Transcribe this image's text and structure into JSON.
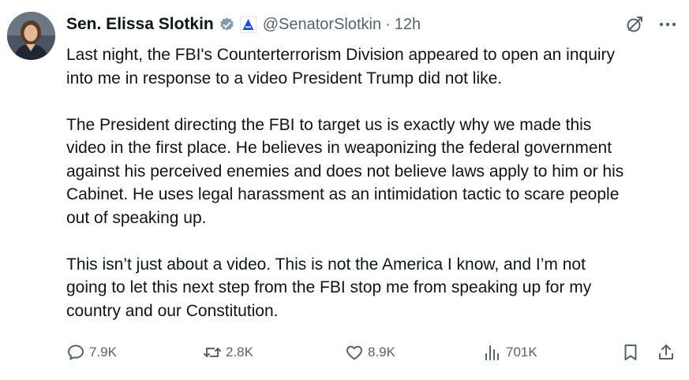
{
  "tweet": {
    "author_name": "Sen. Elissa Slotkin",
    "handle": "@SenatorSlotkin",
    "separator": "·",
    "time": "12h",
    "paragraphs": [
      {
        "lines": [
          "Last night, the FBI's Counterterrorism Division appeared to open an inquiry",
          "into me in response to a video President Trump did not like."
        ]
      },
      {
        "lines": [
          "The President directing the FBI to target us is exactly why we made this",
          "video in the first place. He believes in weaponizing the federal government",
          "against his perceived enemies and does not believe laws apply to him or his",
          "Cabinet. He uses legal harassment as an intimidation tactic to scare people",
          "out of speaking up."
        ]
      },
      {
        "lines": [
          "This isn’t just about a video. This is not the America I know, and I’m not",
          "going to let this next step from the FBI stop me from speaking up for my",
          "country and our Constitution."
        ]
      }
    ],
    "metrics": {
      "replies": "7.9K",
      "reposts": "2.8K",
      "likes": "8.9K",
      "views": "701K"
    }
  },
  "icons": {
    "verified": "verified-badge-icon",
    "government": "government-label-icon",
    "grok": "grok-icon",
    "more": "more-icon",
    "reply": "reply-icon",
    "repost": "repost-icon",
    "like": "heart-icon",
    "views": "views-icon",
    "bookmark": "bookmark-icon",
    "share": "share-icon"
  },
  "colors": {
    "text": "#0f1419",
    "secondary": "#536471",
    "verified_badge": "#829aab",
    "gov_badge": "#1d4ed8"
  }
}
